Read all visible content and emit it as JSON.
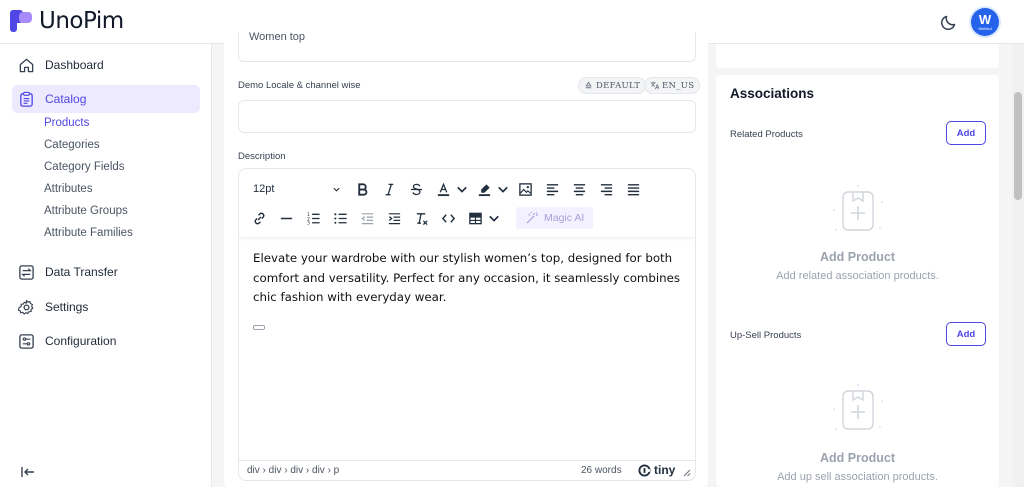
{
  "app": {
    "name": "UnoPim",
    "user_initial": "W",
    "user_subtitle": "Webkul"
  },
  "colors": {
    "accent": "#4f46e5",
    "accent_light": "#ede9fe",
    "avatar": "#2563eb"
  },
  "sidebar": {
    "items": [
      {
        "label": "Dashboard",
        "icon": "home-icon"
      },
      {
        "label": "Catalog",
        "icon": "clipboard-icon",
        "active": true
      },
      {
        "label": "Data Transfer",
        "icon": "transfer-icon"
      },
      {
        "label": "Settings",
        "icon": "gear-icon"
      },
      {
        "label": "Configuration",
        "icon": "sliders-icon"
      }
    ],
    "catalog_children": [
      "Products",
      "Categories",
      "Category Fields",
      "Attributes",
      "Attribute Groups",
      "Attribute Families"
    ]
  },
  "form": {
    "top_field_value": "Women top",
    "demo_field": {
      "label": "Demo Locale & channel wise",
      "channel_badge": "DEFAULT",
      "locale_badge": "EN_US",
      "value": ""
    },
    "description": {
      "label": "Description",
      "font_size": "12pt",
      "magic_ai_label": "Magic AI",
      "content": "Elevate your wardrobe with our stylish women’s top, designed for both comfort and versatility. Perfect for any occasion, it seamlessly combines chic fashion with everyday wear.",
      "path": "div › div › div › div › p",
      "word_count": "26 words",
      "brand": "tiny"
    }
  },
  "associations": {
    "title": "Associations",
    "sections": [
      {
        "label": "Related Products",
        "button": "Add",
        "empty_title": "Add Product",
        "empty_sub": "Add related association products."
      },
      {
        "label": "Up-Sell Products",
        "button": "Add",
        "empty_title": "Add Product",
        "empty_sub": "Add up sell association products."
      }
    ]
  }
}
